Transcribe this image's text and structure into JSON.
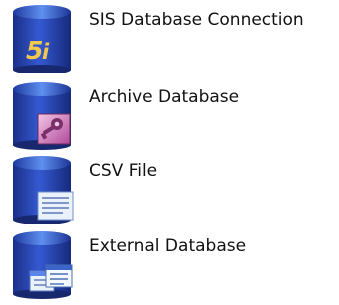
{
  "sources": [
    {
      "label": "SIS Database Connection",
      "icon": "sis-database-icon",
      "overlay_text": "5i"
    },
    {
      "label": "Archive Database",
      "icon": "archive-database-icon"
    },
    {
      "label": "CSV File",
      "icon": "csv-file-icon"
    },
    {
      "label": "External Database",
      "icon": "external-database-icon"
    }
  ],
  "colors": {
    "cylinder_dark": "#1f3fa8",
    "cylinder_light": "#5b86e8",
    "label_text": "#111111",
    "logo_text": "#f2c94c",
    "archive_badge": "#a43a8a"
  }
}
